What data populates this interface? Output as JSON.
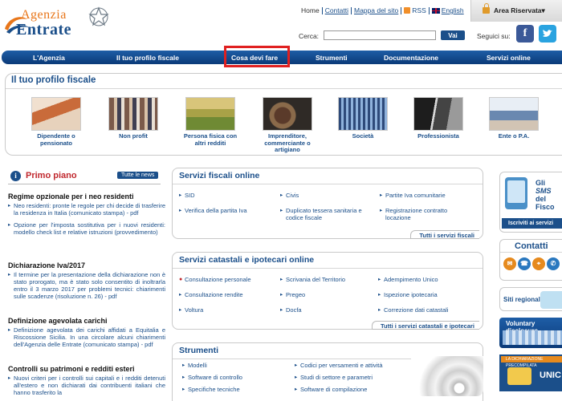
{
  "logo": {
    "line1": "Agenzia",
    "line2": "Entrate"
  },
  "toplinks": {
    "home": "Home",
    "contatti": "Contatti",
    "mappa": "Mappa del sito",
    "rss": "RSS",
    "english": "English"
  },
  "area_riservata": "Area Riservata▾",
  "search": {
    "label": "Cerca:",
    "placeholder": "",
    "button": "Vai"
  },
  "follow_label": "Seguici su:",
  "nav": [
    "L'Agenzia",
    "Il tuo profilo fiscale",
    "Cosa devi fare",
    "Strumenti",
    "Documentazione",
    "Servizi online"
  ],
  "profilo": {
    "title": "Il tuo profilo fiscale",
    "items": [
      "Dipendente o pensionato",
      "Non profit",
      "Persona fisica con altri redditi",
      "Imprenditore, commerciante o artigiano",
      "Società",
      "Professionista",
      "Ente o P.A."
    ]
  },
  "primo_piano": {
    "title": "Primo piano",
    "all_button": "Tutte le news",
    "news": [
      {
        "title": "Regime opzionale per i neo residenti",
        "items": [
          "Neo residenti: pronte le regole per chi decide di trasferire la residenza in Italia (comunicato stampa) - pdf",
          "Opzione per l'imposta sostitutiva per i nuovi residenti: modello check list e relative istruzioni (provvedimento)"
        ]
      },
      {
        "title": "Dichiarazione Iva/2017",
        "items": [
          "Il termine per la presentazione della dichiarazione non è stato prorogato, ma è stato solo consentito di inoltrarla entro il 3 marzo 2017 per problemi tecnici: chiarimenti sulle scadenze (risoluzione n. 26) - pdf"
        ]
      },
      {
        "title": "Definizione agevolata carichi",
        "items": [
          "Definizione agevolata dei carichi affidati a Equitalia e Riscossione Sicilia. In una circolare alcuni chiarimenti dell'Agenzia delle Entrate (comunicato stampa) - pdf"
        ]
      },
      {
        "title": "Controlli su patrimoni e redditi esteri",
        "items": [
          "Nuovi criteri per i controlli sui capitali e i redditi detenuti all'estero e non dichiarati dai contribuenti italiani che hanno trasferito la"
        ]
      }
    ]
  },
  "servizi_fiscali": {
    "title": "Servizi fiscali online",
    "items": [
      "SID",
      "Civis",
      "Partite Iva comunitarie",
      "Verifica della partita Iva",
      "Duplicato tessera sanitaria e codice fiscale",
      "Registrazione contratto locazione"
    ],
    "footer": "Tutti i servizi fiscali"
  },
  "servizi_catastali": {
    "title": "Servizi catastali e ipotecari online",
    "items": [
      "Consultazione personale",
      "Scrivania del Territorio",
      "Adempimento Unico",
      "Consultazione rendite",
      "Pregeo",
      "Ispezione ipotecaria",
      "Voltura",
      "Docfa",
      "Correzione dati catastali"
    ],
    "footer": "Tutti i servizi catastali e ipotecari"
  },
  "strumenti": {
    "title": "Strumenti",
    "items": [
      "Modelli",
      "Codici per versamenti e attività",
      "Software di controllo",
      "Studi di settore e parametri",
      "Specifiche tecniche",
      "Software di compilazione"
    ]
  },
  "sidebar": {
    "sms_text": [
      "Gli",
      "SMS",
      "del",
      "Fisco"
    ],
    "sms_button": "Iscriviti ai servizi",
    "contatti": "Contatti",
    "siti_regionali": "Siti regionali",
    "voluntary": "Voluntary disclosure",
    "unico_top": "LA DICHIARAZIONE PRECOMPILATA",
    "unico": "UNIC"
  },
  "colors": {
    "brand_blue": "#1b4f8a",
    "brand_orange": "#e8761a",
    "highlight_red": "#e02020"
  }
}
